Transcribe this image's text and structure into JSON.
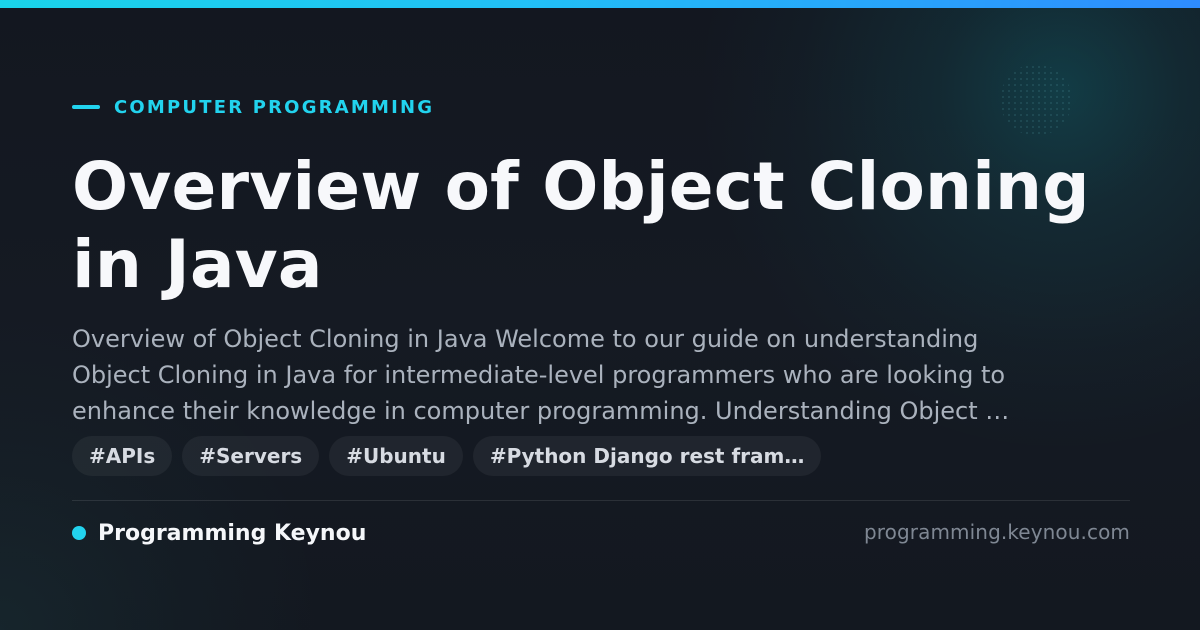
{
  "article": {
    "category": "COMPUTER PROGRAMMING",
    "title": "Overview of Object Cloning in Java",
    "description_lines": [
      "Overview of Object Cloning in Java Welcome to our guide on understanding",
      "Object Cloning in Java for intermediate-level programmers who are looking to",
      "enhance their knowledge in computer programming. Understanding Object …"
    ],
    "tags": [
      "#APIs",
      "#Servers",
      "#Ubuntu",
      "#Python Django rest fram…"
    ]
  },
  "footer": {
    "brand_name": "Programming Keynou",
    "domain": "programming.keynou.com"
  },
  "colors": {
    "accent": "#22d3ee",
    "background": "#141821",
    "title": "#f7f8fb",
    "description": "#aab2bd",
    "tag_background": "#1e232c"
  }
}
